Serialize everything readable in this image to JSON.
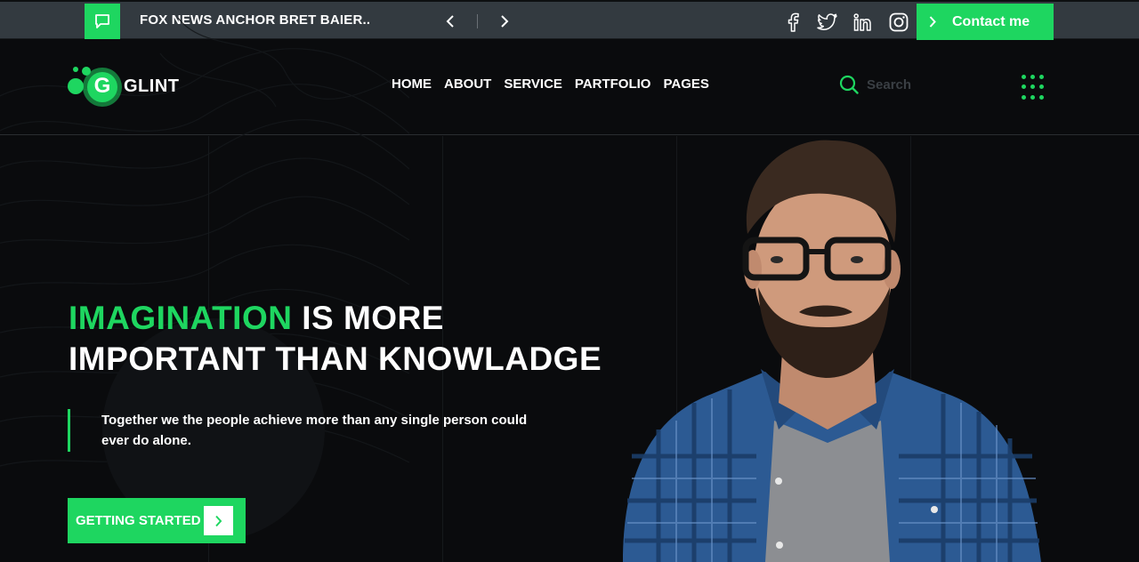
{
  "topbar": {
    "ticker_text": "FOX NEWS ANCHOR BRET BAIER..",
    "social": [
      "facebook-icon",
      "twitter-icon",
      "linkedin-icon",
      "instagram-icon"
    ],
    "contact_label": "Contact me"
  },
  "header": {
    "logo_letter": "G",
    "logo_text": "GLINT",
    "nav": [
      "HOME",
      "ABOUT",
      "SERVICE",
      "PARTFOLIO",
      "PAGES"
    ],
    "search_placeholder": "Search"
  },
  "hero": {
    "headline_accent": "IMAGINATION",
    "headline_rest": " IS MORE",
    "headline_line2": "IMPORTANT THAN KNOWLADGE",
    "quote": "Together we the people achieve more than any single person could ever do alone.",
    "cta_label": "GETTING STARTED"
  },
  "colors": {
    "accent": "#1ed660",
    "topbar_bg": "#333a40",
    "page_bg": "#0a0b0d",
    "text": "#ffffff"
  }
}
